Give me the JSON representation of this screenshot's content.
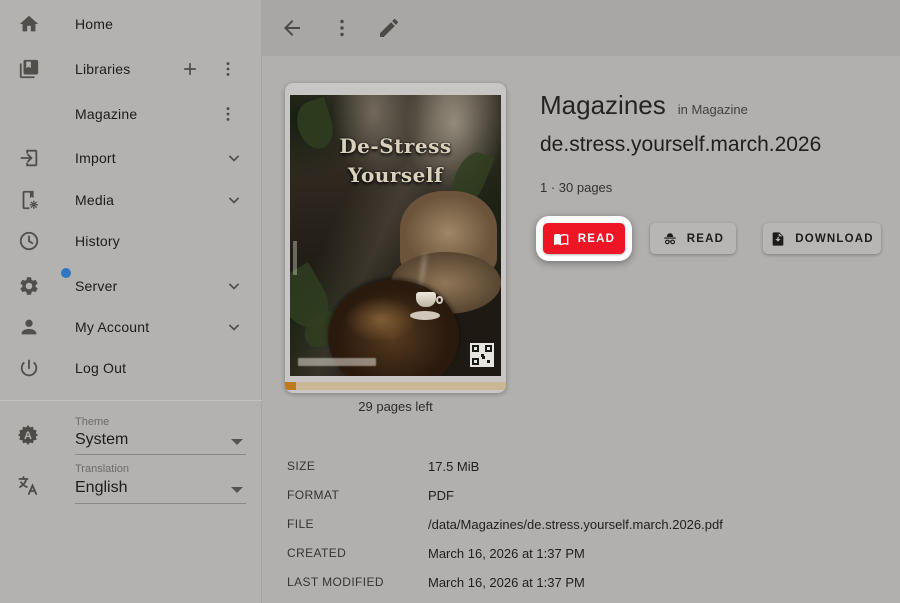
{
  "sidebar": {
    "items": [
      {
        "label": "Home"
      },
      {
        "label": "Libraries"
      },
      {
        "label": "Magazine"
      },
      {
        "label": "Import"
      },
      {
        "label": "Media"
      },
      {
        "label": "History"
      },
      {
        "label": "Server"
      },
      {
        "label": "My Account"
      },
      {
        "label": "Log Out"
      }
    ],
    "theme": {
      "label": "Theme",
      "value": "System"
    },
    "translation": {
      "label": "Translation",
      "value": "English"
    }
  },
  "main": {
    "series_title": "Magazines",
    "series_context": "in Magazine",
    "item_title": "de.stress.yourself.march.2026",
    "pages_info": "1 · 30 pages",
    "pages_left": "29 pages left",
    "cover": {
      "title_line1": "De-Stress",
      "title_line2": "Yourself"
    },
    "buttons": {
      "read": "READ",
      "read_incognito": "READ",
      "download": "DOWNLOAD"
    },
    "details": [
      {
        "label": "SIZE",
        "value": "17.5 MiB"
      },
      {
        "label": "FORMAT",
        "value": "PDF"
      },
      {
        "label": "FILE",
        "value": "/data/Magazines/de.stress.yourself.march.2026.pdf"
      },
      {
        "label": "CREATED",
        "value": "March 16, 2026 at 1:37 PM"
      },
      {
        "label": "LAST MODIFIED",
        "value": "March 16, 2026 at 1:37 PM"
      }
    ]
  },
  "colors": {
    "accent_red": "#ee1525",
    "highlight_ring": "#ffffff",
    "progress_track": "#ccb794",
    "progress_fill": "#bf7a1e",
    "notification_dot": "#2e76c2"
  }
}
